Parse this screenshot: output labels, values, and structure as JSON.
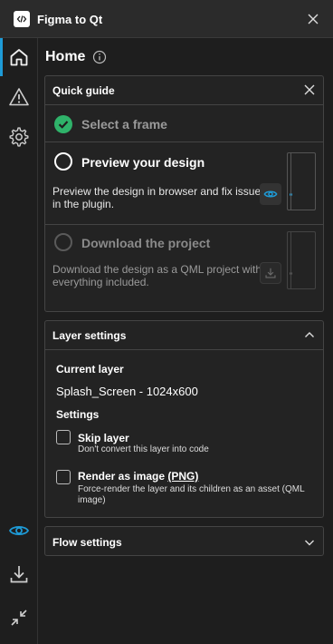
{
  "window": {
    "title": "Figma to Qt",
    "logo_icon": "code-brackets-icon",
    "close_icon": "close-icon"
  },
  "sidebar": {
    "top_items": [
      {
        "name": "home",
        "icon": "home-icon",
        "active": true
      },
      {
        "name": "warnings",
        "icon": "warning-icon"
      },
      {
        "name": "settings",
        "icon": "gear-icon"
      }
    ],
    "bottom_items": [
      {
        "name": "preview",
        "icon": "eye-icon"
      },
      {
        "name": "download",
        "icon": "download-icon"
      },
      {
        "name": "collapse",
        "icon": "shrink-icon"
      }
    ],
    "accent_color": "#1e9bd7"
  },
  "page": {
    "title": "Home"
  },
  "quick_guide": {
    "title": "Quick guide",
    "steps": [
      {
        "label": "Select a frame",
        "state": "done"
      },
      {
        "label": "Preview your design",
        "state": "current",
        "description": "Preview the design in browser and fix issues in the plugin."
      },
      {
        "label": "Download the project",
        "state": "pending",
        "description": "Download the design as a QML project with everything included."
      }
    ],
    "done_color": "#2fb36a"
  },
  "layer_settings": {
    "title": "Layer settings",
    "current_layer_label": "Current layer",
    "current_layer_value": "Splash_Screen - 1024x600",
    "settings_label": "Settings",
    "options": [
      {
        "title": "Skip layer",
        "description": "Don't convert this layer into code",
        "checked": false
      },
      {
        "title_prefix": "Render as image",
        "title_link": "(PNG)",
        "description": "Force-render the layer and its children as an asset (QML image)",
        "checked": false
      }
    ]
  },
  "flow_settings": {
    "title": "Flow settings"
  }
}
